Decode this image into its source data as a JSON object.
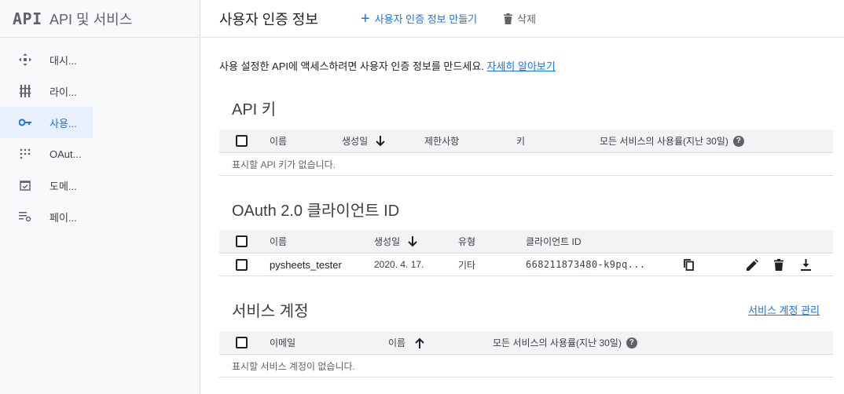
{
  "sidebar": {
    "logo": "API",
    "title": "API 및 서비스",
    "items": [
      {
        "label": "대시..."
      },
      {
        "label": "라이..."
      },
      {
        "label": "사용..."
      },
      {
        "label": "OAut..."
      },
      {
        "label": "도메..."
      },
      {
        "label": "페이..."
      }
    ]
  },
  "header": {
    "title": "사용자 인증 정보",
    "create_label": "사용자 인증 정보 만들기",
    "delete_label": "삭제"
  },
  "intro": {
    "text": "사용 설정한 API에 액세스하려면 사용자 인증 정보를 만드세요. ",
    "link": "자세히 알아보기"
  },
  "api_keys": {
    "title": "API 키",
    "columns": [
      "이름",
      "생성일",
      "제한사항",
      "키",
      "모든 서비스의 사용률(지난 30일)"
    ],
    "empty": "표시할 API 키가 없습니다."
  },
  "oauth": {
    "title": "OAuth 2.0 클라이언트 ID",
    "columns": [
      "이름",
      "생성일",
      "유형",
      "클라이언트 ID"
    ],
    "rows": [
      {
        "name": "pysheets_tester",
        "created": "2020. 4. 17.",
        "type": "기타",
        "client_id": "668211873480-k9pq..."
      }
    ]
  },
  "service_accounts": {
    "title": "서비스 계정",
    "manage_link": "서비스 계정 관리",
    "columns": [
      "이메일",
      "이름",
      "모든 서비스의 사용률(지난 30일)"
    ],
    "empty": "표시할 서비스 계정이 없습니다."
  },
  "colors": {
    "accent": "#1a73e8",
    "sidebar_active_bg": "#e8f0fe",
    "header_bg": "#f1f3f4"
  }
}
